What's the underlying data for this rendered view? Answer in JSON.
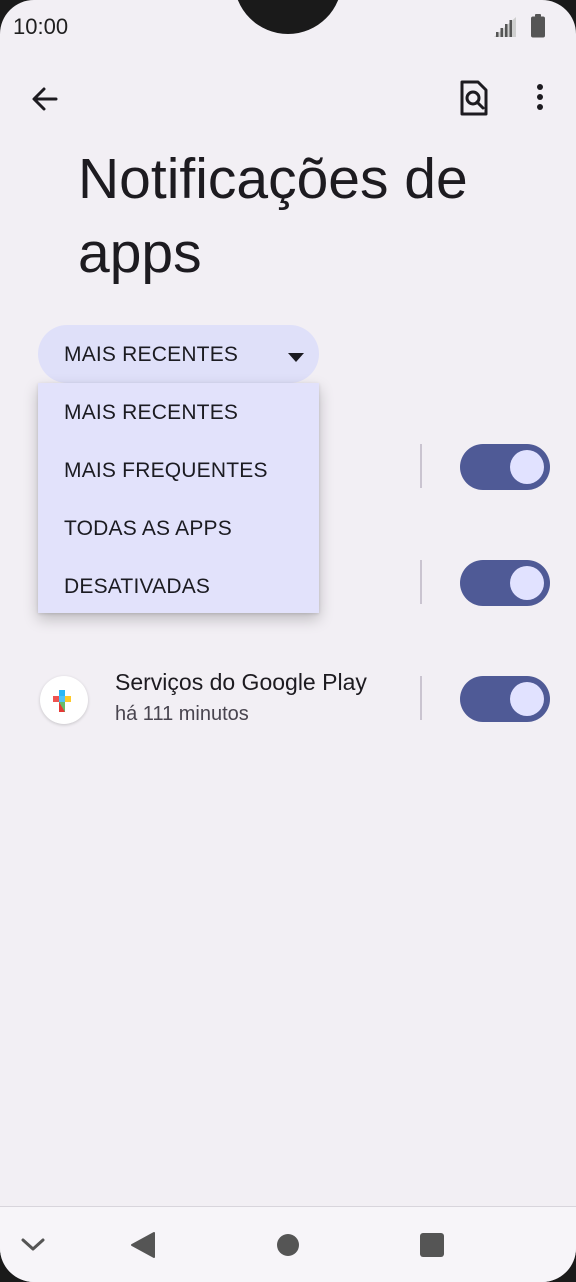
{
  "status_bar": {
    "time": "10:00"
  },
  "header": {
    "title": "Notificações de apps"
  },
  "filter": {
    "selected": "MAIS RECENTES",
    "options": [
      "MAIS RECENTES",
      "MAIS FREQUENTES",
      "TODAS AS APPS",
      "DESATIVADAS"
    ]
  },
  "apps": [
    {
      "name": "Serviços do Google Play",
      "time": "há 111 minutos",
      "enabled": true
    }
  ],
  "colors": {
    "background": "#f2eff4",
    "toggle_on": "#4f5a96",
    "dropdown": "#dfe0f9"
  },
  "icons": [
    "back-arrow-icon",
    "search-settings-icon",
    "more-vert-icon",
    "signal-icon",
    "battery-icon",
    "caret-down-icon",
    "google-play-services-icon"
  ]
}
